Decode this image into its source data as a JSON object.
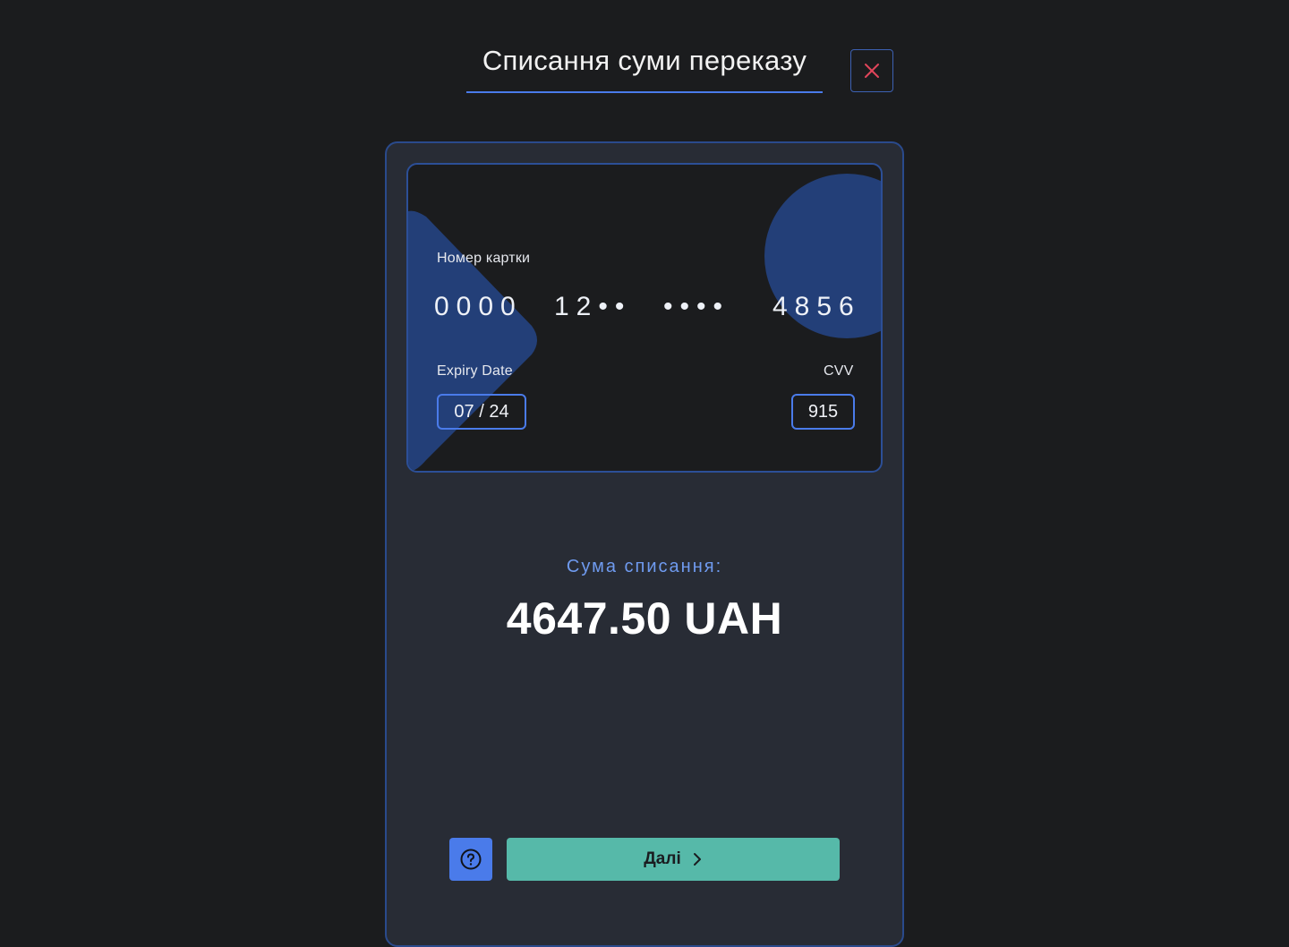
{
  "header": {
    "title": "Списання суми переказу",
    "close_icon": "close-icon",
    "accent_color": "#4a7bea",
    "close_color": "#e0455a"
  },
  "card": {
    "number_label": "Номер картки",
    "number_groups": [
      "0000",
      "12••",
      "••••",
      "4856"
    ],
    "expiry_label": "Expiry Date",
    "expiry_value": "07 / 24",
    "cvv_label": "CVV",
    "cvv_value": "915",
    "deco_color": "#233f78"
  },
  "summary": {
    "label": "Сума списання:",
    "amount": "4647.50 UAH",
    "label_color": "#6f9bf0"
  },
  "actions": {
    "help_icon": "question-circle-icon",
    "next_label": "Далі",
    "next_icon": "chevron-right-icon",
    "next_color": "#56b9a9",
    "help_color": "#4a7bea"
  }
}
